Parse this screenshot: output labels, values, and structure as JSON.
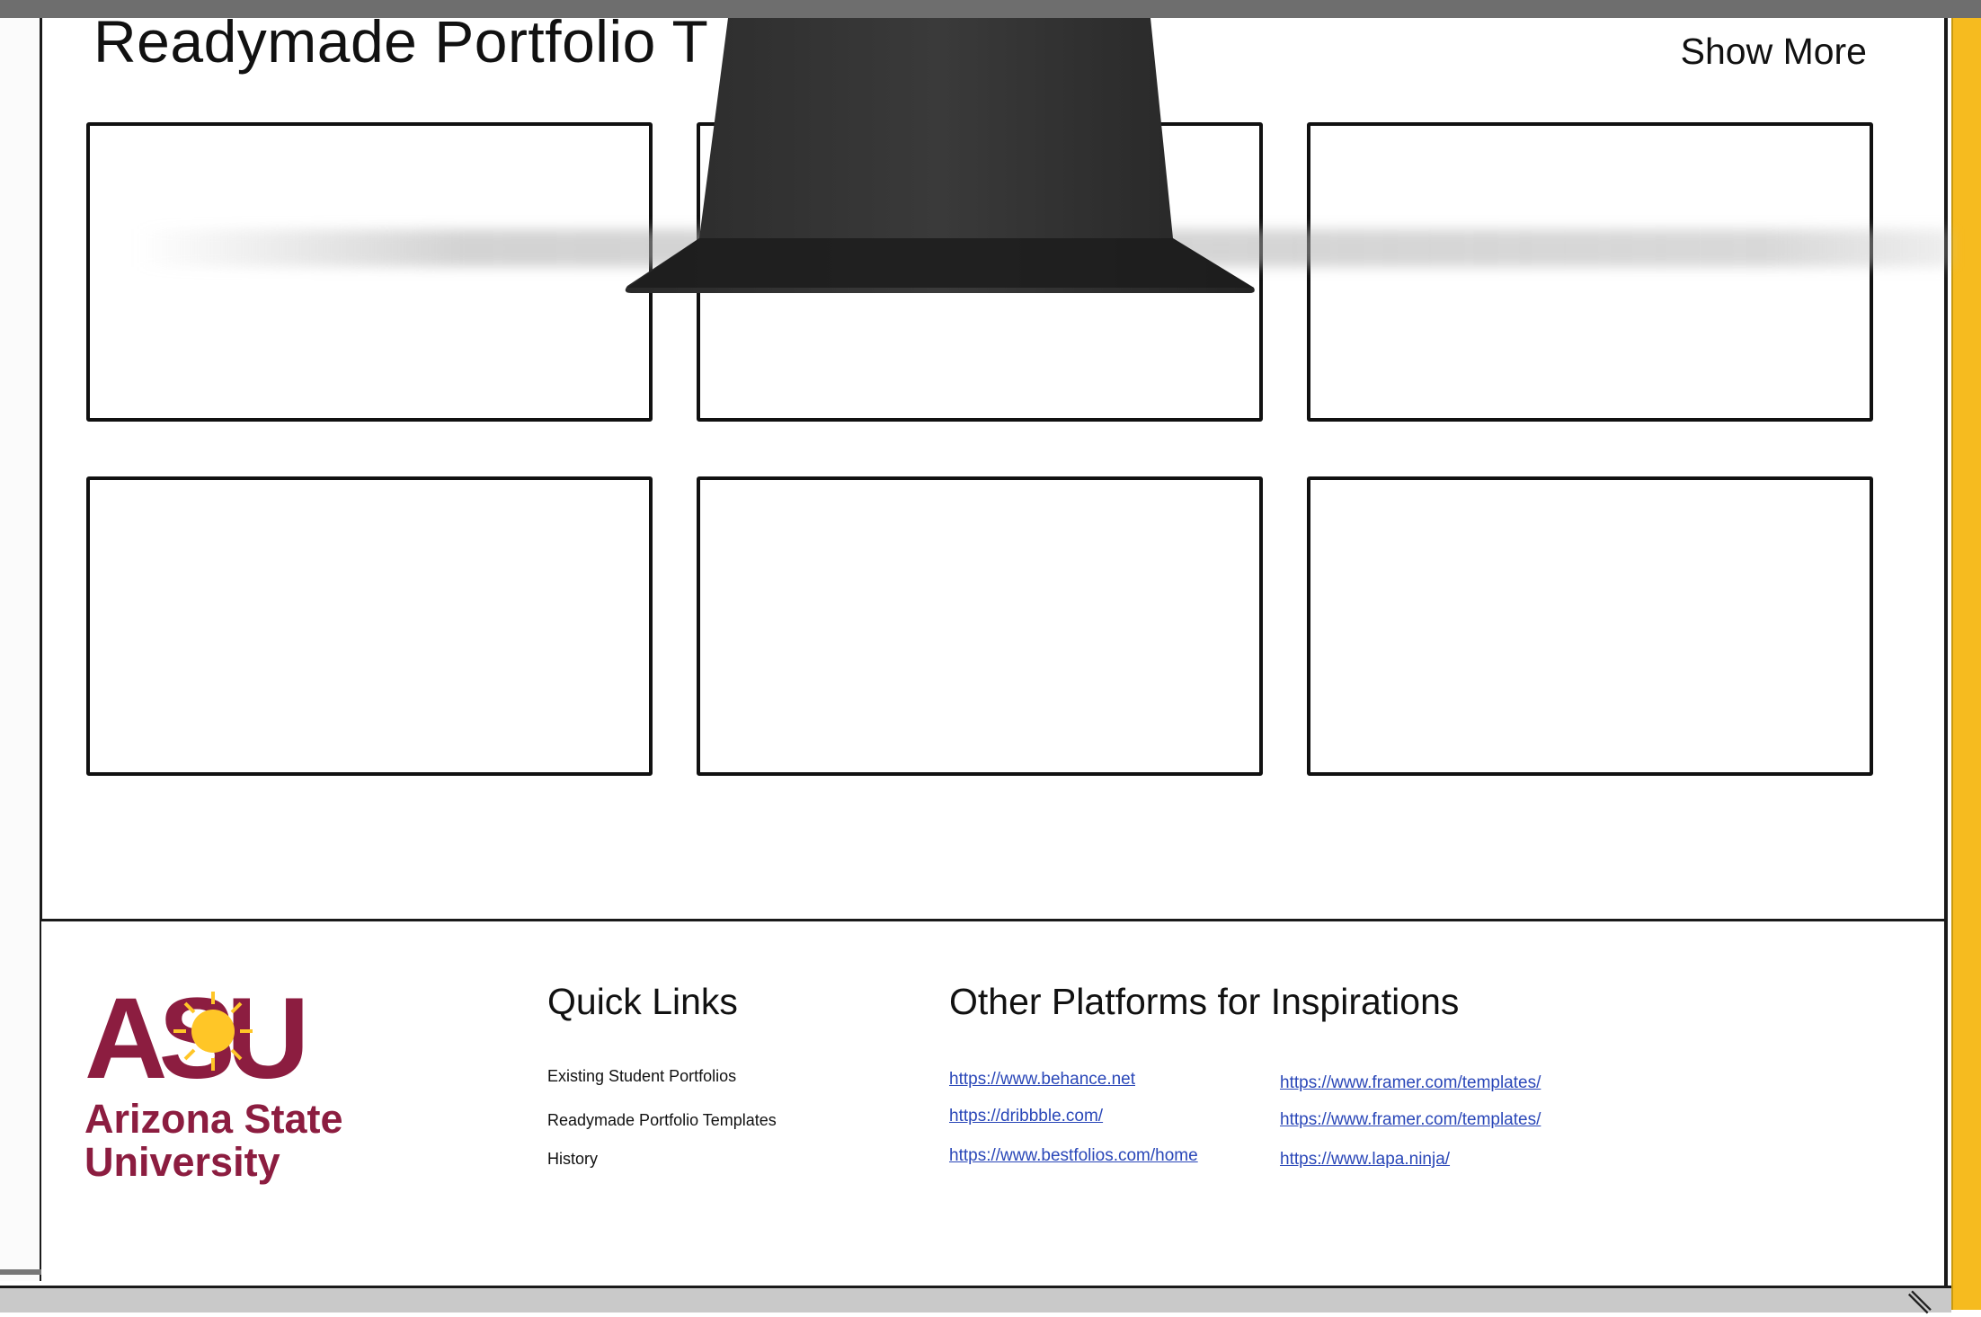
{
  "section": {
    "title": "Readymade Portfolio T",
    "show_more_label": "Show More",
    "cards": [
      {
        "id": 1
      },
      {
        "id": 2
      },
      {
        "id": 3
      },
      {
        "id": 4
      },
      {
        "id": 5
      },
      {
        "id": 6
      }
    ]
  },
  "footer": {
    "logo": {
      "mark": "ASU",
      "name_line1": "Arizona State",
      "name_line2": "University"
    },
    "quick_links": {
      "heading": "Quick Links",
      "items": [
        "Existing Student Portfolios",
        "Readymade Portfolio Templates",
        "History"
      ]
    },
    "platforms": {
      "heading": "Other Platforms for Inspirations",
      "col1": [
        "https://www.behance.net",
        "https://dribbble.com/",
        "https://www.bestfolios.com/home"
      ],
      "col2": [
        "https://www.framer.com/templates/",
        "https://www.framer.com/templates/",
        "https://www.lapa.ninja/"
      ]
    }
  },
  "colors": {
    "asu_maroon": "#8c1d40",
    "asu_gold": "#ffc627",
    "link_blue": "#2a47b8",
    "rail_yellow": "#f6bb1f"
  },
  "icons": [
    "monitor-stand-obstruction",
    "resize-grip-icon",
    "asu-sunburst-logo"
  ]
}
